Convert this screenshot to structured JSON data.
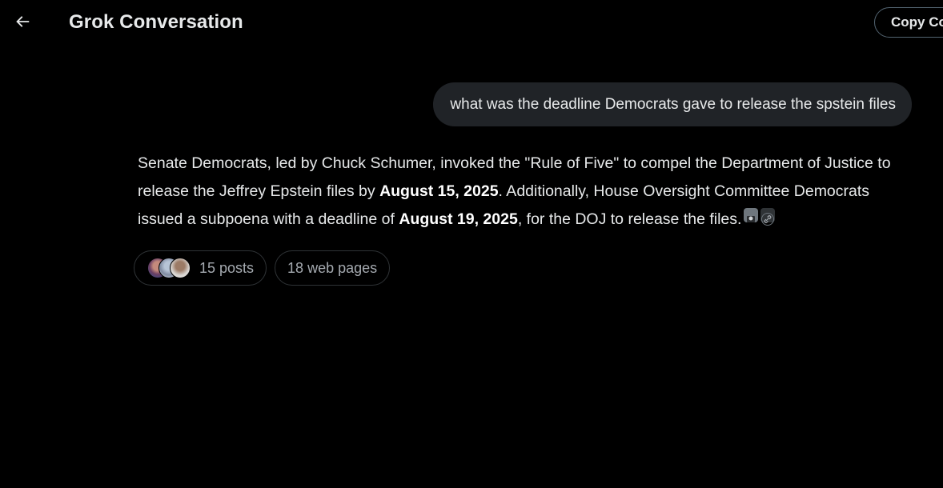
{
  "header": {
    "back_icon": "arrow-left-icon",
    "title": "Grok Conversation",
    "copy_button_label": "Copy Co"
  },
  "conversation": {
    "user_message": "what was the deadline Democrats gave to release the spstein files",
    "answer": {
      "part1": "Senate Democrats, led by Chuck Schumer, invoked the \"Rule of Five\" to compel the Department of Justice to release the Jeffrey Epstein files by ",
      "bold1": "August 15, 2025",
      "part2": ". Additionally, House Oversight Committee Democrats issued a subpoena with a deadline of ",
      "bold2": "August 19, 2025",
      "part3": ", for the DOJ to release the files."
    },
    "citation_icons": [
      "x-post-citation-icon",
      "link-citation-icon"
    ]
  },
  "sources": {
    "posts_label": "15 posts",
    "web_pages_label": "18 web pages"
  },
  "colors": {
    "background": "#000000",
    "text": "#e7e9ea",
    "bubble": "#202327",
    "chip_border": "#2f3336",
    "muted": "#a5aab0"
  }
}
